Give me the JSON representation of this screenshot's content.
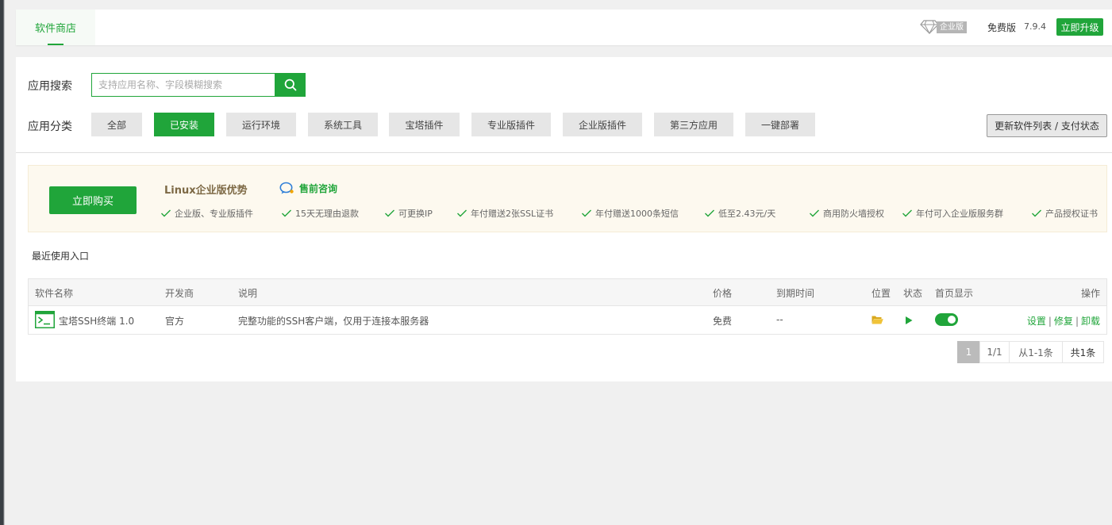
{
  "header": {
    "tab_label": "软件商店",
    "enterprise_badge": "企业版",
    "edition": "免费版",
    "version": "7.9.4",
    "upgrade_label": "立即升级"
  },
  "search": {
    "label": "应用搜索",
    "placeholder": "支持应用名称、字段模糊搜索",
    "value": ""
  },
  "categories": {
    "label": "应用分类",
    "items": [
      "全部",
      "已安装",
      "运行环境",
      "系统工具",
      "宝塔插件",
      "专业版插件",
      "企业版插件",
      "第三方应用",
      "一键部署"
    ],
    "active": "已安装"
  },
  "refresh_label": "更新软件列表 / 支付状态",
  "promo": {
    "buy_label": "立即购买",
    "title": "Linux企业版优势",
    "consult_label": "售前咨询",
    "features": [
      "企业版、专业版插件",
      "15天无理由退款",
      "可更换IP",
      "年付赠送2张SSL证书",
      "年付赠送1000条短信",
      "低至2.43元/天",
      "商用防火墙授权",
      "年付可入企业版服务群",
      "产品授权证书"
    ]
  },
  "recent_label": "最近使用入口",
  "table": {
    "headers": {
      "name": "软件名称",
      "developer": "开发商",
      "desc": "说明",
      "price": "价格",
      "expiry": "到期时间",
      "location": "位置",
      "status": "状态",
      "homepage": "首页显示",
      "actions": "操作"
    },
    "rows": [
      {
        "name": "宝塔SSH终端 1.0",
        "developer": "官方",
        "desc": "完整功能的SSH客户端，仅用于连接本服务器",
        "price": "免费",
        "expiry": "--",
        "homepage_enabled": true,
        "actions": [
          "设置",
          "修复",
          "卸载"
        ]
      }
    ]
  },
  "pagination": {
    "current": "1",
    "pages": "1/1",
    "range": "从1-1条",
    "total": "共1条"
  },
  "colors": {
    "brand": "#20a53a",
    "promo_bg": "#fdf9ef",
    "promo_title": "#7d6945"
  }
}
